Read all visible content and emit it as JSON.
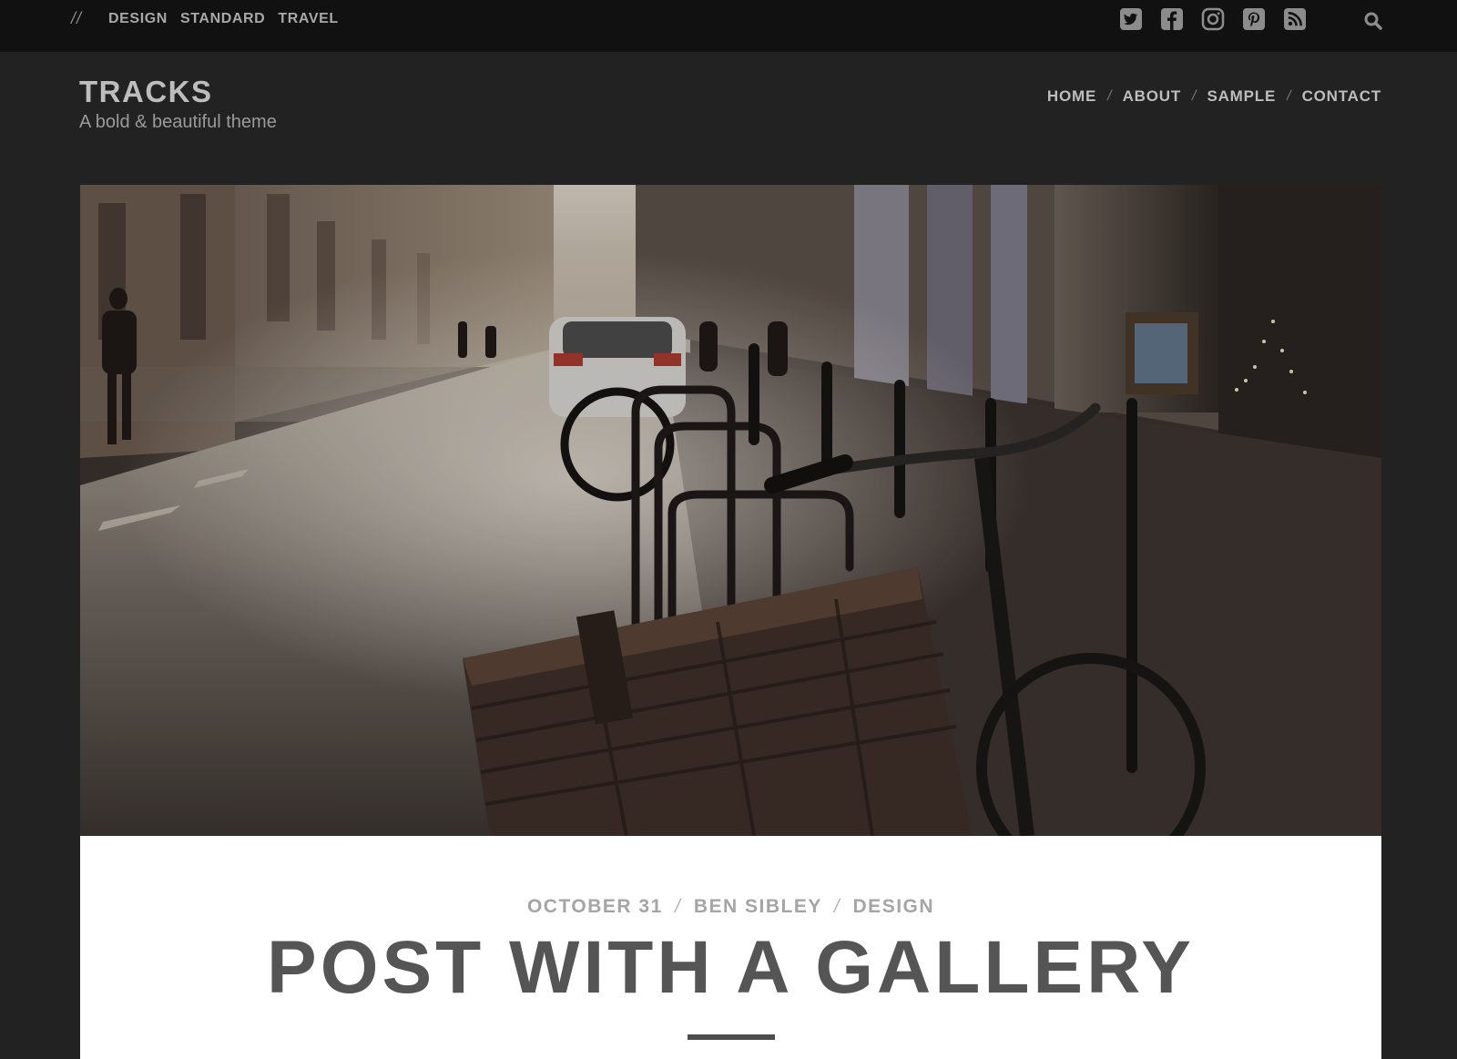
{
  "topbar": {
    "slashes": "//",
    "categories": [
      "DESIGN",
      "STANDARD",
      "TRAVEL"
    ],
    "social_icons": [
      "twitter-icon",
      "facebook-icon",
      "instagram-icon",
      "pinterest-icon",
      "rss-icon"
    ],
    "search_icon": "search-icon"
  },
  "header": {
    "site_title": "TRACKS",
    "tagline": "A bold & beautiful theme",
    "nav": [
      "HOME",
      "ABOUT",
      "SAMPLE",
      "CONTACT"
    ],
    "nav_separator": "/"
  },
  "post": {
    "date": "OCTOBER 31",
    "author": "BEN SIBLEY",
    "category": "DESIGN",
    "meta_separator": "/",
    "title": "POST WITH A GALLERY"
  },
  "colors": {
    "page_bg": "#222222",
    "topbar_bg": "#111111",
    "card_bg": "#ffffff",
    "title_text": "#555555",
    "meta_text": "#a5a5a5"
  }
}
